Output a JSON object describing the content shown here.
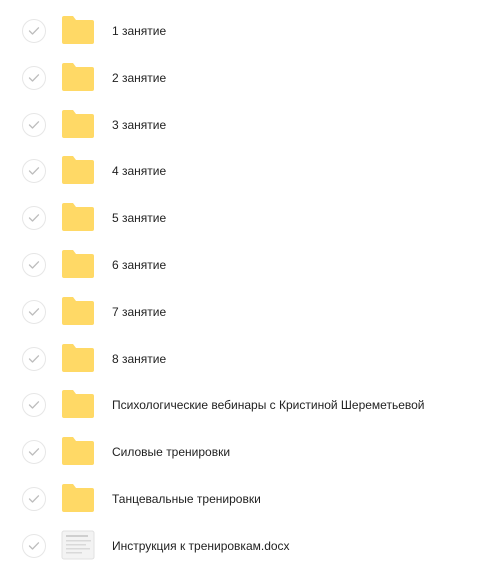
{
  "files": [
    {
      "name": "1 занятие",
      "type": "folder"
    },
    {
      "name": "2 занятие",
      "type": "folder"
    },
    {
      "name": "3 занятие",
      "type": "folder"
    },
    {
      "name": "4 занятие",
      "type": "folder"
    },
    {
      "name": "5 занятие",
      "type": "folder"
    },
    {
      "name": "6 занятие",
      "type": "folder"
    },
    {
      "name": "7 занятие",
      "type": "folder"
    },
    {
      "name": "8 занятие",
      "type": "folder"
    },
    {
      "name": "Психологические вебинары с Кристиной Шереметьевой",
      "type": "folder"
    },
    {
      "name": "Силовые тренировки",
      "type": "folder"
    },
    {
      "name": "Танцевальные тренировки",
      "type": "folder"
    },
    {
      "name": "Инструкция к тренировкам.docx",
      "type": "document"
    }
  ],
  "icons": {
    "folder": "folder-icon",
    "document": "document-icon",
    "select": "checkmark-icon"
  },
  "colors": {
    "folder": "#ffd966",
    "checkmark": "#bdbdbd",
    "select_border": "#e6e6e6"
  }
}
